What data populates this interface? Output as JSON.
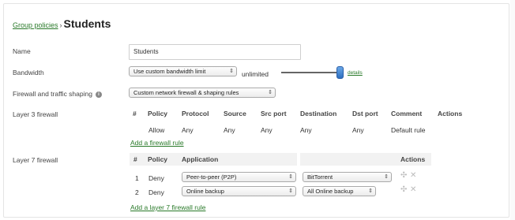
{
  "breadcrumb": {
    "link": "Group policies",
    "separator": "›",
    "title": "Students"
  },
  "name": {
    "label": "Name",
    "value": "Students"
  },
  "bandwidth": {
    "label": "Bandwidth",
    "select": "Use custom bandwidth limit",
    "unlimited": "unlimited",
    "slider_level": 1.0,
    "details": "details"
  },
  "firewall_shaping": {
    "label": "Firewall and traffic shaping",
    "info_icon": "info-icon",
    "select": "Custom network firewall & shaping rules"
  },
  "layer3": {
    "label": "Layer 3 firewall",
    "headers": [
      "#",
      "Policy",
      "Protocol",
      "Source",
      "Src port",
      "Destination",
      "Dst port",
      "Comment",
      "Actions"
    ],
    "rows": [
      {
        "num": "",
        "policy": "Allow",
        "protocol": "Any",
        "source": "Any",
        "src_port": "Any",
        "destination": "Any",
        "dst_port": "Any",
        "comment": "Default rule"
      }
    ],
    "add_link": "Add a firewall rule"
  },
  "layer7": {
    "label": "Layer 7 firewall",
    "headers": [
      "#",
      "Policy",
      "Application",
      "Actions"
    ],
    "rows": [
      {
        "num": "1",
        "policy": "Deny",
        "application": "Peer-to-peer (P2P)",
        "target": "BitTorrent"
      },
      {
        "num": "2",
        "policy": "Deny",
        "application": "Online backup",
        "target": "All Online backup"
      }
    ],
    "add_link": "Add a layer 7 firewall rule"
  },
  "icons": {
    "move": "move-icon",
    "delete": "delete-icon",
    "dropdown": "chevron-updown-icon"
  },
  "colors": {
    "link": "#2a7a2a",
    "slider_handle": "#2e6fc0"
  }
}
